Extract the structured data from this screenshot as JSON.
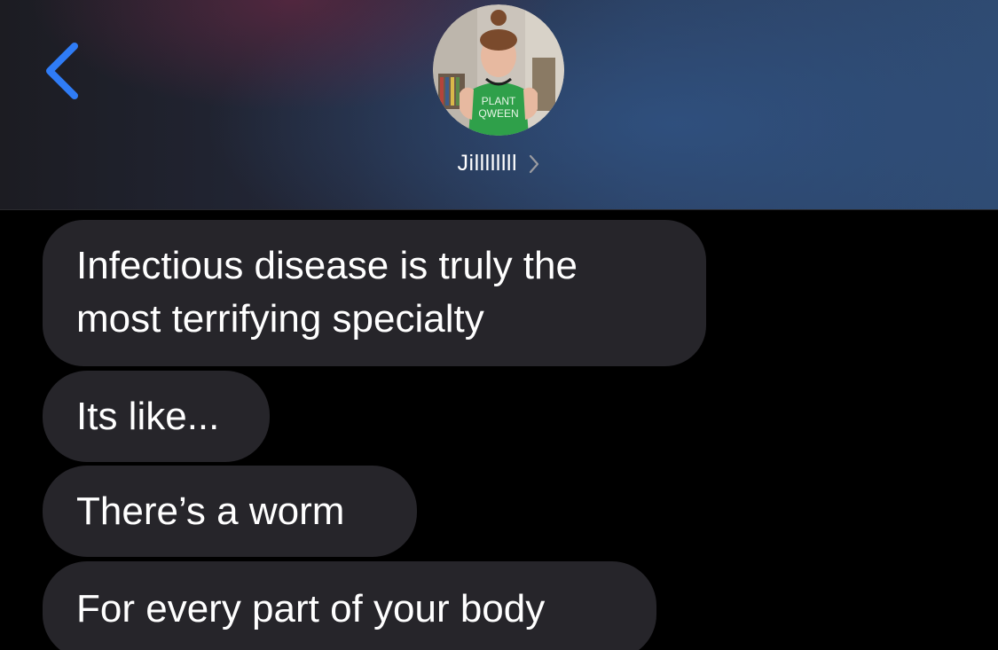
{
  "header": {
    "back_icon": "chevron-left-icon",
    "accent_color": "#2f7cf6",
    "avatar": {
      "shirt_text_line1": "PLANT",
      "shirt_text_line2": "QWEEN"
    },
    "contact_name": "Jillllllll",
    "contact_chevron_icon": "chevron-right-icon"
  },
  "messages": [
    {
      "sender": "received",
      "lines": [
        "Infectious disease is truly the",
        "most terrifying specialty"
      ]
    },
    {
      "sender": "received",
      "lines": [
        "Its like..."
      ]
    },
    {
      "sender": "received",
      "lines": [
        "There’s a worm"
      ]
    },
    {
      "sender": "received",
      "lines": [
        "For every part of your body"
      ]
    }
  ],
  "colors": {
    "background": "#000000",
    "received_bubble": "#26252a",
    "text": "#ffffff"
  }
}
